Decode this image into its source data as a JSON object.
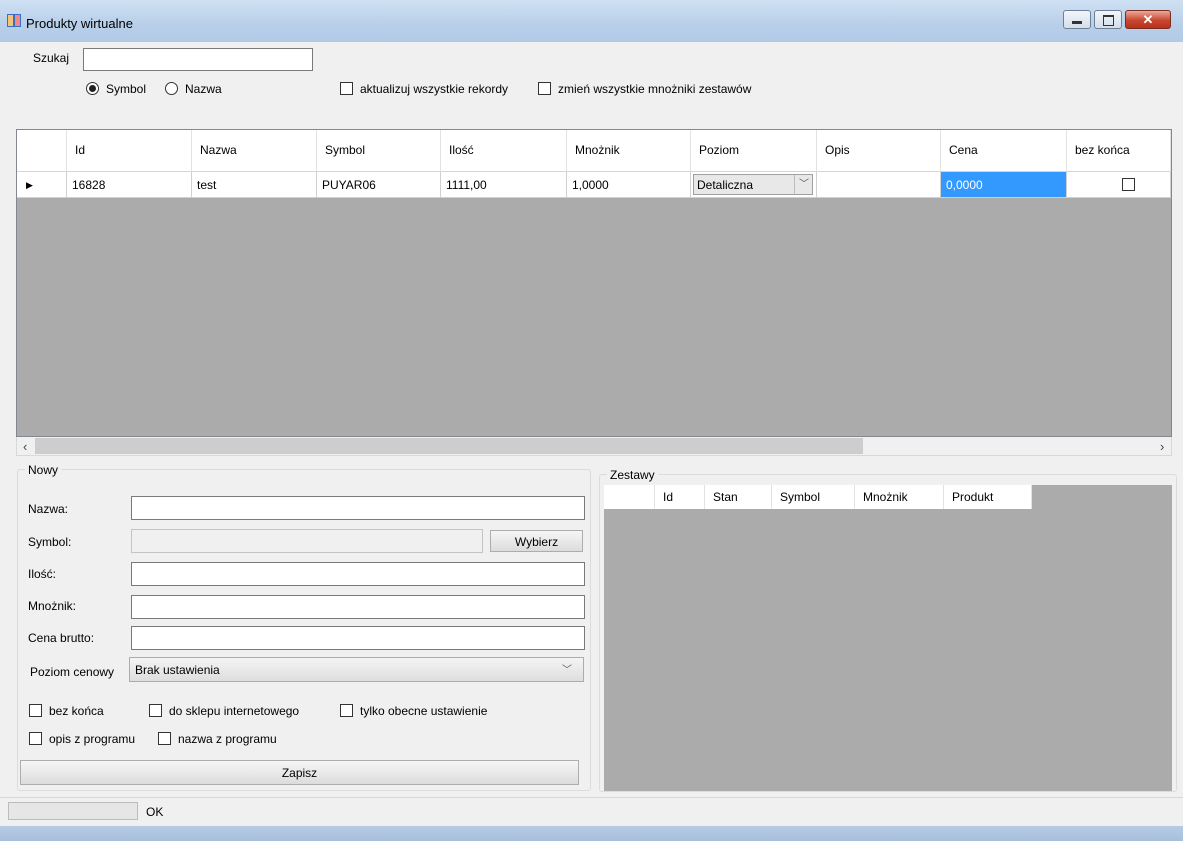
{
  "window": {
    "title": "Produkty wirtualne"
  },
  "search": {
    "label": "Szukaj",
    "value": "",
    "radio_symbol": "Symbol",
    "radio_nazwa": "Nazwa",
    "selected": "Symbol",
    "chk_update_all": "aktualizuj wszystkie rekordy",
    "chk_change_multipliers": "zmień wszystkie mnożniki zestawów"
  },
  "grid": {
    "columns": [
      "Id",
      "Nazwa",
      "Symbol",
      "Ilość",
      "Mnożnik",
      "Poziom",
      "Opis",
      "Cena",
      "bez końca"
    ],
    "rows": [
      {
        "id": "16828",
        "nazwa": "test",
        "symbol": "PUYAR06",
        "ilosc": "1111,00",
        "mnoznik": "1,0000",
        "poziom": "Detaliczna",
        "opis": "",
        "cena": "0,0000",
        "bez_konca": false
      }
    ]
  },
  "nowy": {
    "group_label": "Nowy",
    "nazwa_label": "Nazwa:",
    "symbol_label": "Symbol:",
    "wybierz_label": "Wybierz",
    "ilosc_label": "Ilość:",
    "mnoznik_label": "Mnożnik:",
    "cena_label": "Cena brutto:",
    "poziom_label": "Poziom cenowy",
    "poziom_value": "Brak ustawienia",
    "chk_bez_konca": "bez końca",
    "chk_do_sklepu": "do sklepu internetowego",
    "chk_tylko_obecne": "tylko obecne ustawienie",
    "chk_opis": "opis z programu",
    "chk_nazwa": "nazwa z programu",
    "zapisz_label": "Zapisz"
  },
  "zestawy": {
    "group_label": "Zestawy",
    "columns": [
      "Id",
      "Stan",
      "Symbol",
      "Mnożnik",
      "Produkt"
    ]
  },
  "status": {
    "text": "OK"
  },
  "colors": {
    "selection": "#3399ff",
    "grid_bg": "#ababab",
    "title_bar": "#b8cfe9"
  }
}
